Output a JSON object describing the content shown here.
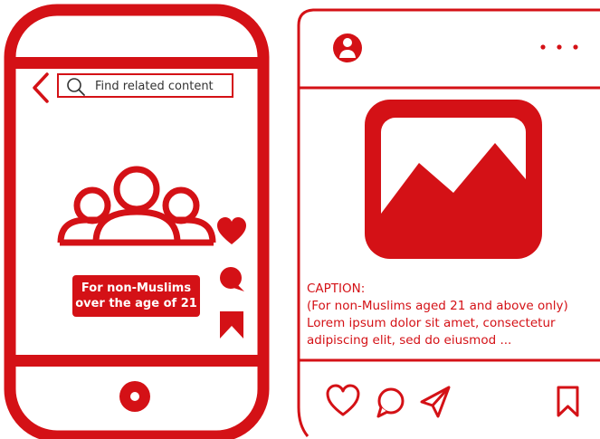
{
  "phone": {
    "search_placeholder": "Find related content",
    "badge_line1": "For non-Muslims",
    "badge_line2": "over the age of 21"
  },
  "post": {
    "caption_title": "CAPTION:",
    "caption_line1": "(For non-Muslims aged 21 and above only)",
    "caption_line2": "Lorem ipsum dolor sit amet, consectetur",
    "caption_line3": "adipiscing elit, sed do eiusmod ..."
  },
  "colors": {
    "accent": "#d41116",
    "background": "#ffffff"
  },
  "icons": {
    "back": "chevron-left-icon",
    "search": "search-icon",
    "group": "people-group-icon",
    "like": "heart-icon",
    "comment": "comment-icon",
    "bookmark": "bookmark-icon",
    "home": "home-button-icon",
    "avatar": "user-avatar-icon",
    "more": "more-dots-icon",
    "image": "image-placeholder-icon",
    "share": "send-icon"
  }
}
